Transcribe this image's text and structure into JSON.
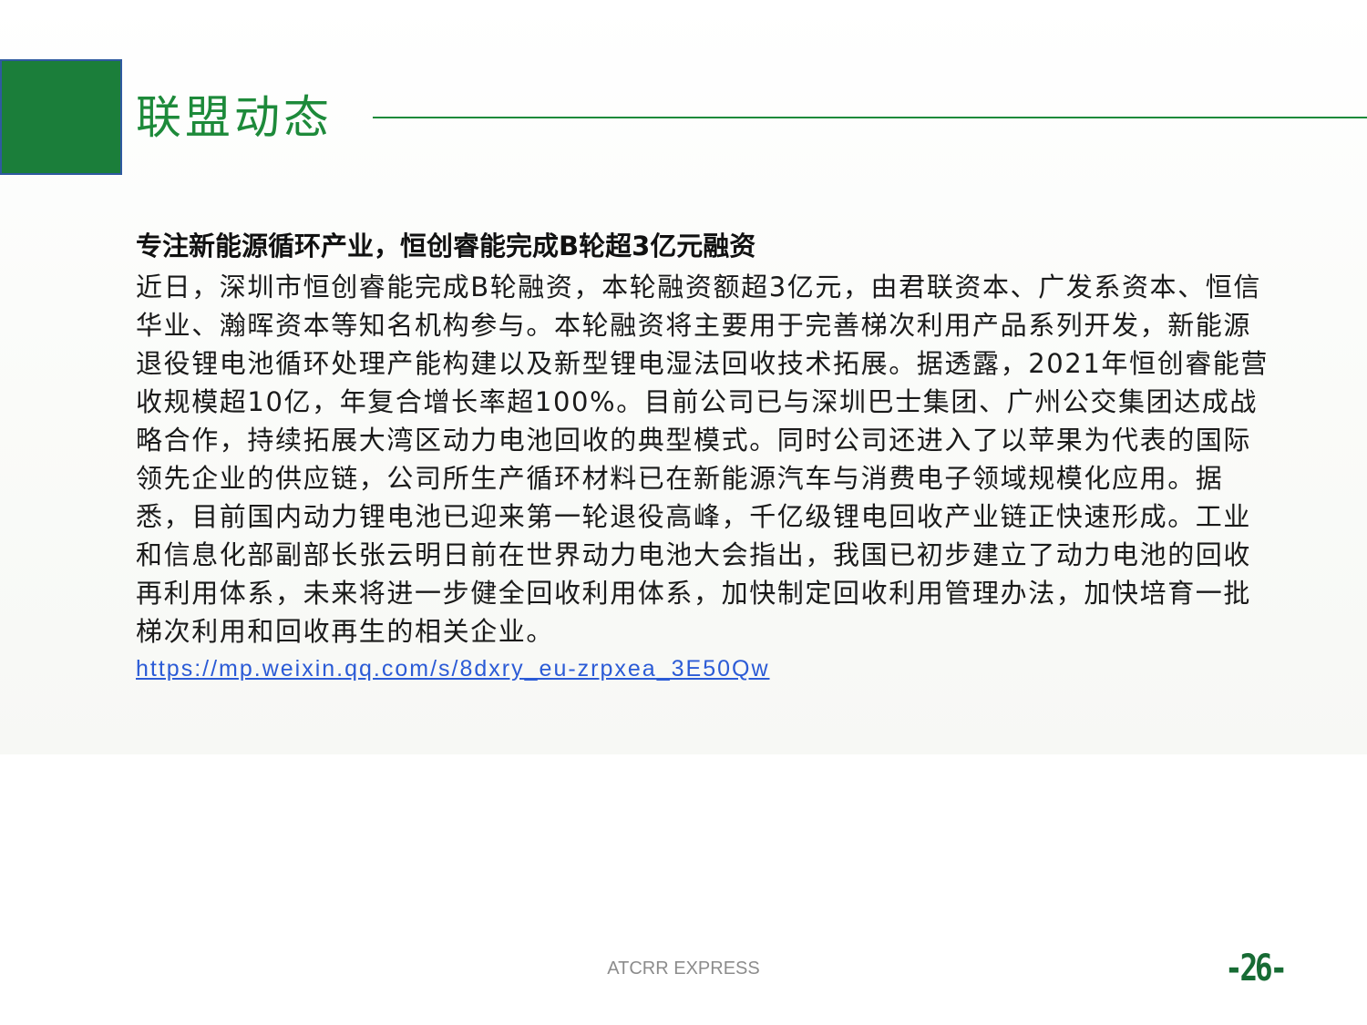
{
  "section": {
    "title": "联盟动态"
  },
  "article": {
    "headline": "专注新能源循环产业，恒创睿能完成B轮超3亿元融资",
    "body": "近日，深圳市恒创睿能完成B轮融资，本轮融资额超3亿元，由君联资本、广发系资本、恒信华业、瀚晖资本等知名机构参与。本轮融资将主要用于完善梯次利用产品系列开发，新能源退役锂电池循环处理产能构建以及新型锂电湿法回收技术拓展。据透露，2021年恒创睿能营收规模超10亿，年复合增长率超100%。目前公司已与深圳巴士集团、广州公交集团达成战略合作，持续拓展大湾区动力电池回收的典型模式。同时公司还进入了以苹果为代表的国际领先企业的供应链，公司所生产循环材料已在新能源汽车与消费电子领域规模化应用。据悉，目前国内动力锂电池已迎来第一轮退役高峰，千亿级锂电回收产业链正快速形成。工业和信息化部副部长张云明日前在世界动力电池大会指出，我国已初步建立了动力电池的回收再利用体系，未来将进一步健全回收利用体系，加快制定回收利用管理办法，加快培育一批梯次利用和回收再生的相关企业。",
    "link_text": "https://mp.weixin.qq.com/s/8dxry_eu-zrpxea_3E50Qw"
  },
  "footer": {
    "brand": "ATCRR EXPRESS",
    "page_number": "-26-"
  },
  "colors": {
    "accent_green": "#1d8a3a",
    "block_green": "#1b7e3a",
    "link_blue": "#2b5bd6"
  }
}
